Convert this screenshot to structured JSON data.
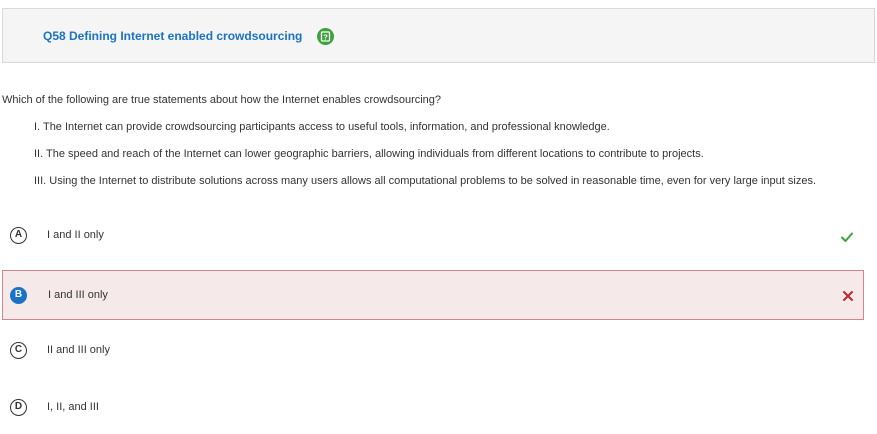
{
  "header": {
    "title": "Q58 Defining Internet enabled crowdsourcing",
    "help_icon": "help-icon"
  },
  "question": {
    "prompt": "Which of the following are true statements about how the Internet enables crowdsourcing?",
    "statements": [
      "I. The Internet can provide crowdsourcing participants access to useful tools, information, and professional knowledge.",
      "II. The speed and reach of the Internet can lower geographic barriers, allowing individuals from different locations to contribute to projects.",
      "III. Using the Internet to distribute solutions across many users allows all computational problems to be solved in reasonable time, even for very large input sizes."
    ]
  },
  "choices": [
    {
      "letter": "A",
      "text": "I and II only",
      "status": "correct",
      "selected": false
    },
    {
      "letter": "B",
      "text": "I and III only",
      "status": "incorrect",
      "selected": true
    },
    {
      "letter": "C",
      "text": "II and III only",
      "status": "none",
      "selected": false
    },
    {
      "letter": "D",
      "text": "I, II, and III",
      "status": "none",
      "selected": false
    }
  ],
  "colors": {
    "title": "#1a73c7",
    "correct": "#3ca33c",
    "incorrect": "#c0282d",
    "selected_bg": "#f6e9ea",
    "selected_border": "#d6848a"
  },
  "icons": {
    "correct": "checkmark-icon",
    "incorrect": "x-icon"
  }
}
